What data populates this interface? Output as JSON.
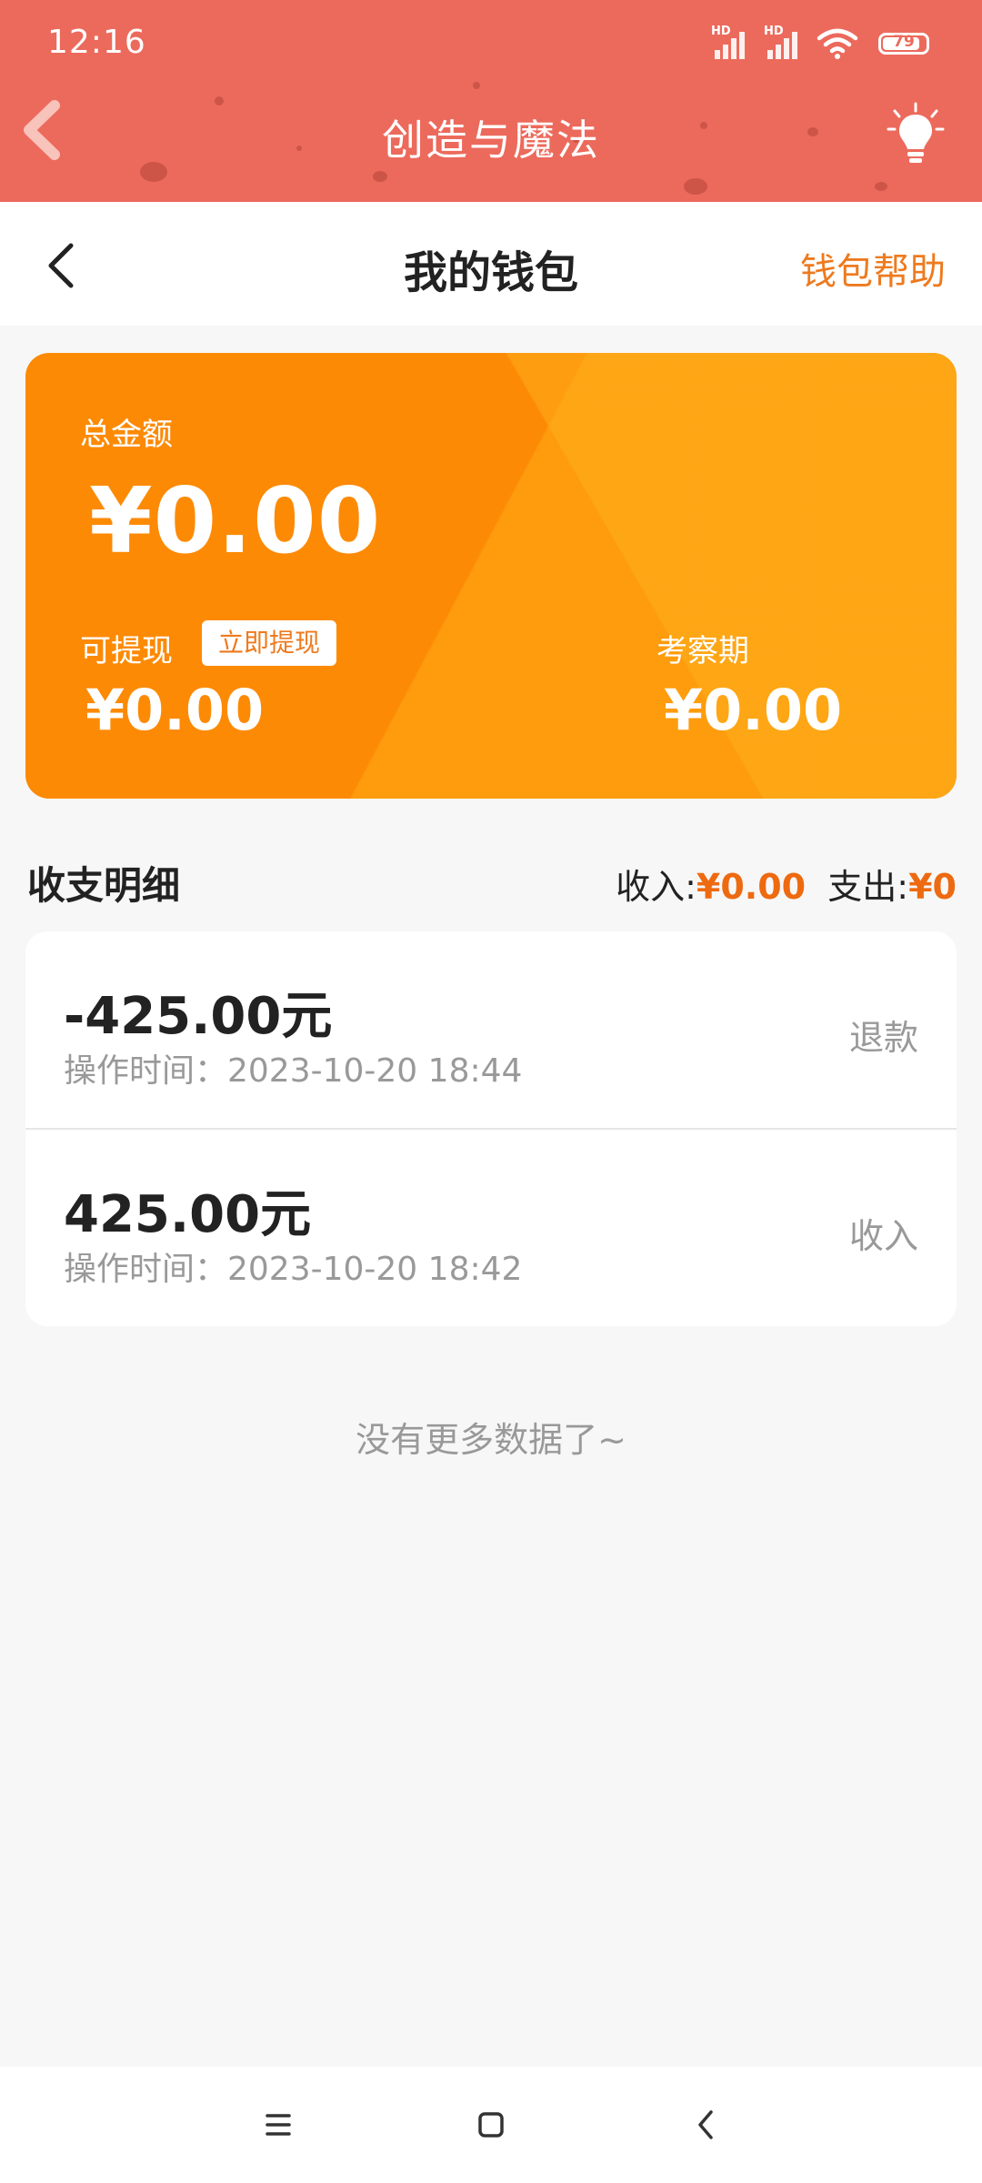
{
  "status_bar": {
    "time": "12:16",
    "signal1_label": "HD",
    "signal2_label": "HD",
    "battery_level": "79"
  },
  "app_bar": {
    "title": "创造与魔法",
    "accent_color": "#ec6a5c"
  },
  "page_header": {
    "title": "我的钱包",
    "help_label": "钱包帮助"
  },
  "wallet": {
    "total_label": "总金额",
    "total_amount": "¥0.00",
    "withdrawable_label": "可提现",
    "withdraw_button": "立即提现",
    "withdrawable_amount": "¥0.00",
    "review_label": "考察期",
    "review_amount": "¥0.00",
    "card_color": "#fd8a05"
  },
  "details": {
    "title": "收支明细",
    "income_label": "收入:",
    "income_value": "¥0.00",
    "expense_label": "支出:",
    "expense_value": "¥0"
  },
  "records": [
    {
      "amount": "-425.00元",
      "time": "操作时间：2023-10-20 18:44",
      "type": "退款"
    },
    {
      "amount": "425.00元",
      "time": "操作时间：2023-10-20 18:42",
      "type": "收入"
    }
  ],
  "footer_text": "没有更多数据了~",
  "nav": {
    "icons": [
      "menu-icon",
      "home-icon",
      "back-icon"
    ]
  }
}
